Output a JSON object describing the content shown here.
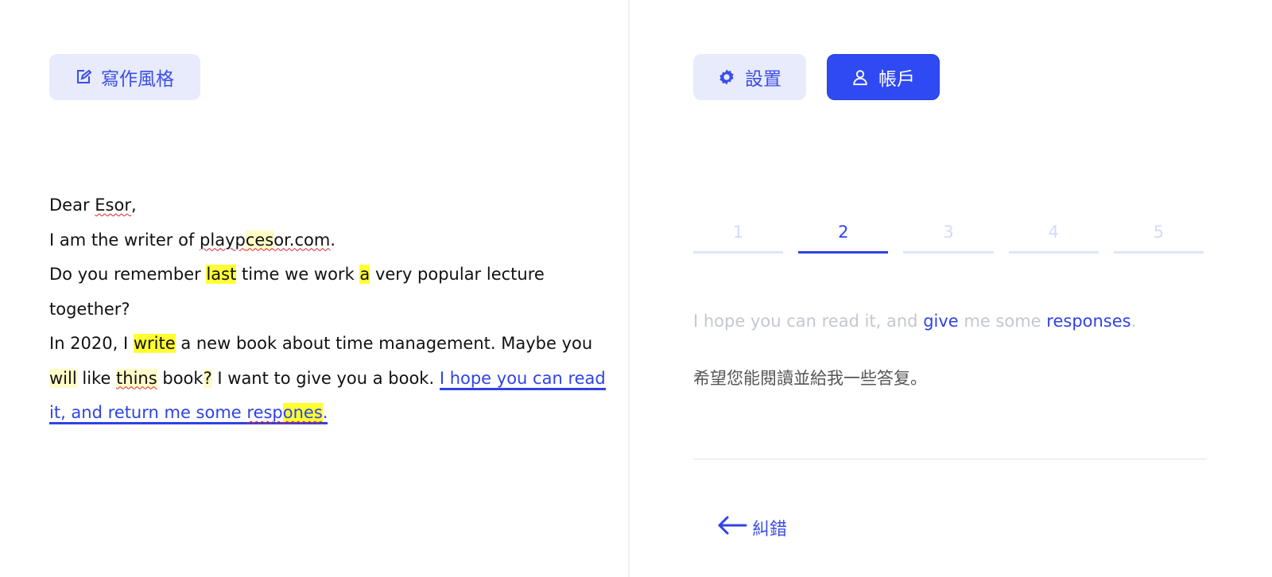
{
  "toolbar": {
    "writing_style_label": "寫作風格",
    "settings_label": "設置",
    "account_label": "帳戶"
  },
  "letter": {
    "line1": {
      "a": "Dear ",
      "b": "Esor",
      "c": ","
    },
    "line2": {
      "a": "I am the writer of ",
      "b1": "playp",
      "b2": "ces",
      "b3": "or.com",
      "c": "."
    },
    "line3": {
      "a": "Do you remember ",
      "b": "last",
      "c": " time we work ",
      "d": "a",
      "e": " very popular lecture together?"
    },
    "line4": {
      "a": "In 2020, I ",
      "b": "write",
      "c": " a new book about time management. Maybe you ",
      "d": "will",
      "e": " like ",
      "f": "thins",
      "g": " book",
      "h": "?",
      "i": "   I want to give you a book.  ",
      "j1": "I hope you can read it, and return me some ",
      "j2": "resp",
      "j3": "ones",
      "j4": "."
    }
  },
  "steps": [
    "1",
    "2",
    "3",
    "4",
    "5"
  ],
  "active_step": "2",
  "suggestion": {
    "part1": "I hope you can read it, and ",
    "kw1": "give",
    "part2": " me some ",
    "kw2": "responses",
    "part3": "."
  },
  "translation": "希望您能閱讀並給我一些答复。",
  "back_label": "糾錯",
  "colors": {
    "accent": "#2f4af2",
    "soft_button": "#e8ebfc",
    "highlight_strong": "#ffff33",
    "highlight_soft": "#fffbc6",
    "spell_error": "#e0242f"
  }
}
